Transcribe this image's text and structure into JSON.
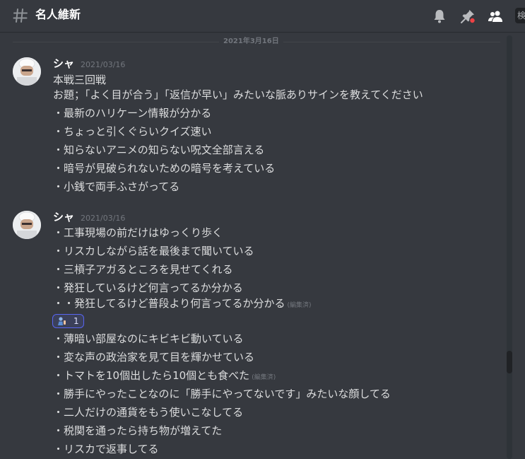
{
  "header": {
    "channel_name": "名人維新",
    "search_stub": "検"
  },
  "date_divider": "2021年3月16日",
  "messages": [
    {
      "author": "シャ",
      "timestamp": "2021/03/16",
      "lines": [
        "本戦三回戦",
        "お題；「よく目が合う」「返信が早い」みたいな脈ありサインを教えてください",
        "・最新のハリケーン情報が分かる",
        "・ちょっと引くぐらいクイズ速い",
        "・知らないアニメの知らない呪文全部言える",
        "・暗号が見破られないための暗号を考えている",
        "・小銭で両手ふさがってる"
      ]
    },
    {
      "author": "シャ",
      "timestamp": "2021/03/16",
      "lines_before_reaction": [
        "・工事現場の前だけはゆっくり歩く",
        "・リスカしながら話を最後まで聞いている",
        "・三槓子アガるところを見せてくれる",
        "・発狂しているけど何言ってるか分かる",
        "・・発狂してるけど普段より何言ってるか分かる"
      ],
      "edited_label_1": "(編集済)",
      "reaction": {
        "emoji": "person-emoji",
        "count": "1"
      },
      "lines_after_reaction": [
        "・薄暗い部屋なのにキビキビ動いている",
        "・変な声の政治家を見て目を輝かせている",
        "・トマトを10個出したら10個とも食べた",
        "・勝手にやったことなのに「勝手にやってないです」みたいな顔してる",
        "・二人だけの通貨をもう使いこなしてる",
        "・税関を通ったら持ち物が増えてた",
        "・リスカで返事してる"
      ],
      "edited_label_2": "(編集済)"
    }
  ],
  "colors": {
    "background": "#36393f",
    "text": "#dcddde",
    "muted": "#72767d",
    "author": "#ffffff",
    "reaction_border": "#5865f2",
    "notification_dot": "#ed4245"
  }
}
